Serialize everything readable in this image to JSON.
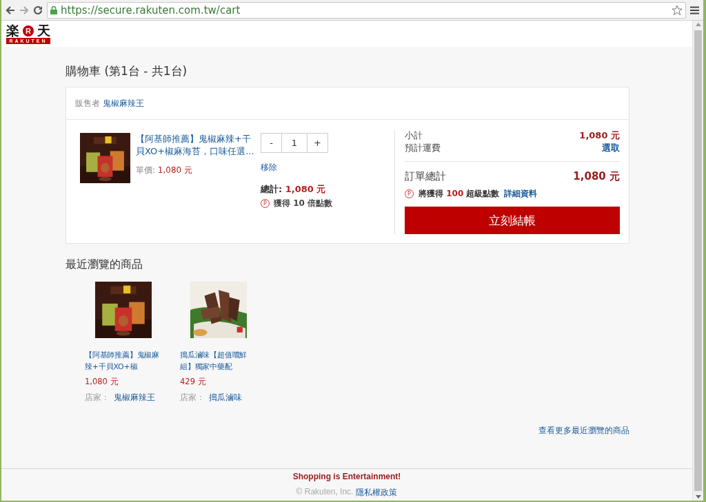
{
  "browser": {
    "url": "https://secure.rakuten.com.tw/cart"
  },
  "logo": {
    "left": "楽",
    "badge": "R",
    "right": "天",
    "bottom": "RAKUTEN"
  },
  "cart": {
    "title": "購物車 (第1台 - 共1台)",
    "seller_label": "販售者",
    "seller": "鬼椒麻辣王",
    "item": {
      "name": "【阿基師推薦】鬼椒麻辣+干貝XO+椒麻海苔，口味任選...",
      "unit_label": "單價:",
      "unit_price": "1,080 元",
      "minus": "-",
      "quantity": "1",
      "plus": "+",
      "remove": "移除",
      "total_label": "總計:",
      "total": "1,080 元",
      "points_icon": "P",
      "points": "獲得 10 倍點數"
    },
    "summary": {
      "subtotal_label": "小計",
      "subtotal": "1,080 元",
      "shipping_label": "預計運費",
      "shipping": "選取",
      "order_total_label": "訂單總計",
      "order_total": "1,080 元",
      "points_icon": "P",
      "points": "將獲得 **100** 超級點數",
      "details": "詳細資料",
      "checkout": "立刻結帳"
    }
  },
  "recent": {
    "title": "最近瀏覽的商品",
    "items": [
      {
        "name": "【阿基師推薦】鬼椒麻辣+干貝XO+椒",
        "price": "1,080 元",
        "store_label": "店家：",
        "store": "鬼椒麻辣王"
      },
      {
        "name": "搗瓜滷味【超值嚐鮮組】獨家中藥配",
        "price": "429 元",
        "store_label": "店家：",
        "store": "搗瓜滷味"
      }
    ],
    "more": "查看更多最近瀏覽的商品"
  },
  "footer": {
    "slogan": "Shopping is Entertainment!",
    "copyright": "© Rakuten, Inc.",
    "privacy": "隱私權政策"
  }
}
